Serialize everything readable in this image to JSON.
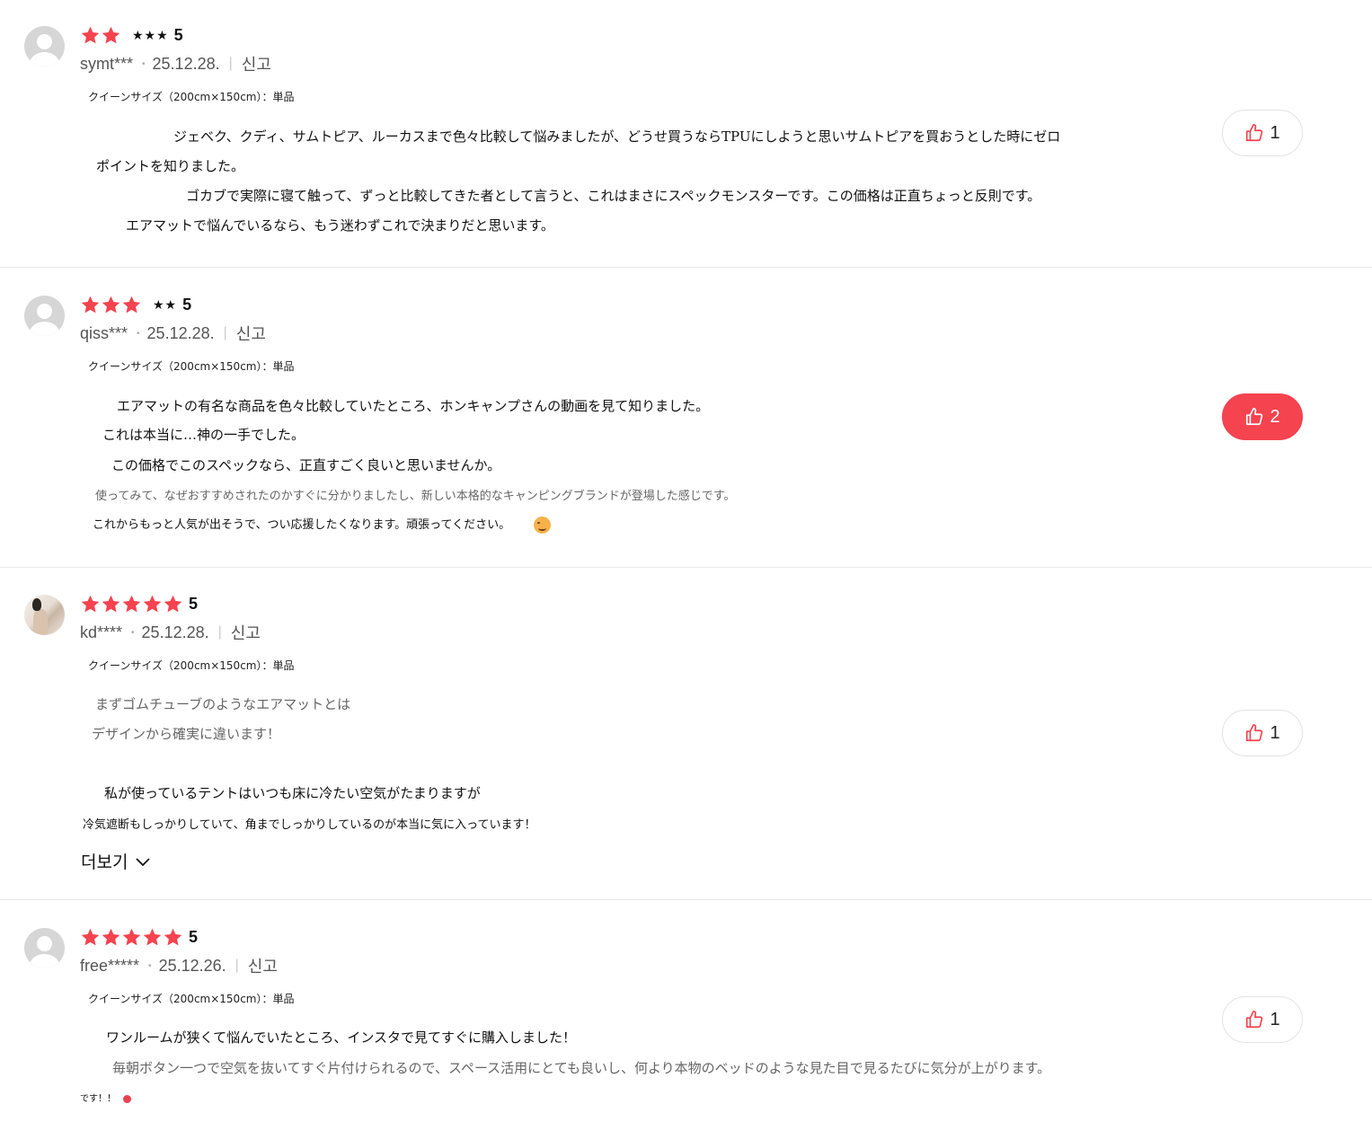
{
  "colors": {
    "accent": "#f5434f",
    "star": "#f5434f",
    "divider": "#e9e9e9"
  },
  "reviews": [
    {
      "stars": "★★",
      "extra": "★★★",
      "score": "5",
      "user": "symt***",
      "date": "25.12.28.",
      "report": "신고",
      "option": "クイーンサイズ（200cm×150cm）：単品",
      "lines": [
        "ジェベク、クディ、サムトピア、ルーカスまで色々比較して悩みましたが、どうせ買うならTPUにしようと思いサムトピアを買おうとした時にゼロ",
        "ポイントを知りました。",
        "ゴカブで実際に寝て触って、ずっと比較してきた者として言うと、これはまさにスペックモンスターです。この価格は正直ちょっと反則です。",
        "エアマットで悩んでいるなら、もう迷わずこれで決まりだと思います。"
      ],
      "likes": "1",
      "liked": false
    },
    {
      "stars": "★★★",
      "extra": "★★",
      "score": "5",
      "user": "qiss***",
      "date": "25.12.28.",
      "report": "신고",
      "option": "クイーンサイズ（200cm×150cm）：単品",
      "lines": [
        "エアマットの有名な商品を色々比較していたところ、ホンキャンプさんの動画を見て知りました。",
        "これは本当に…神の一手でした。",
        "この価格でこのスペックなら、正直すごく良いと思いませんか。",
        "使ってみて、なぜおすすめされたのかすぐに分かりましたし、新しい本格的なキャンピングブランドが登場した感じです。",
        "これからもっと人気が出そうで、つい応援したくなります。頑張ってください。"
      ],
      "likes": "2",
      "liked": true
    },
    {
      "stars": "★★★★★",
      "extra": "",
      "score": "5",
      "user": "kd****",
      "date": "25.12.28.",
      "report": "신고",
      "option": "クイーンサイズ（200cm×150cm）：単品",
      "lines": [
        "まずゴムチューブのようなエアマットとは",
        "デザインから確実に違います！",
        "私が使っているテントはいつも床に冷たい空気がたまりますが",
        "冷気遮断もしっかりしていて、角までしっかりしているのが本当に気に入っています！"
      ],
      "more": "더보기",
      "likes": "1",
      "liked": false
    },
    {
      "stars": "★★★★★",
      "extra": "",
      "score": "5",
      "user": "free*****",
      "date": "25.12.26.",
      "report": "신고",
      "option": "クイーンサイズ（200cm×150cm）：単品",
      "lines": [
        "ワンルームが狭くて悩んでいたところ、インスタで見てすぐに購入しました！",
        "毎朝ボタン一つで空気を抜いてすぐ片付けられるので、スペース活用にとても良いし、何より本物のベッドのような見た目で見るたびに気分が上がります。",
        "です！！"
      ],
      "likes": "1",
      "liked": false
    }
  ]
}
